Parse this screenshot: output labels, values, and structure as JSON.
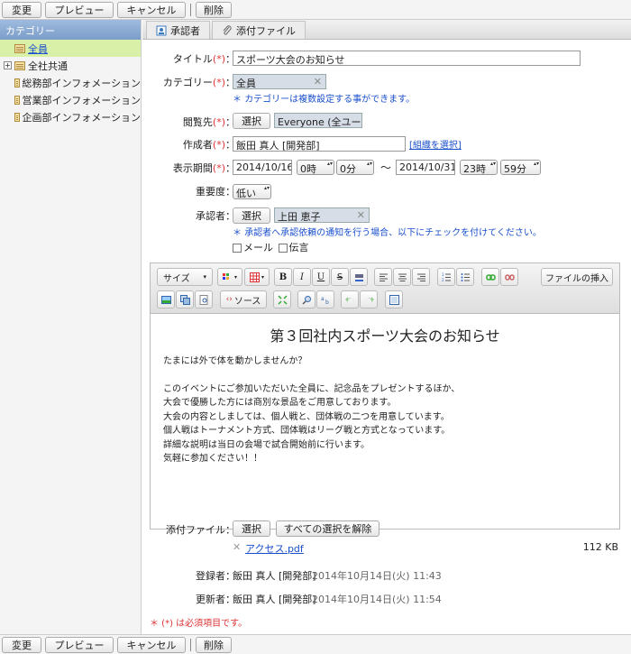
{
  "toolbar": {
    "change": "変更",
    "preview": "プレビュー",
    "cancel": "キャンセル",
    "delete": "削除"
  },
  "sidebar": {
    "header": "カテゴリー",
    "items": [
      {
        "label": "全員",
        "selected": true,
        "expandable": false
      },
      {
        "label": "全社共通",
        "selected": false,
        "expandable": true
      },
      {
        "label": "総務部インフォメーション",
        "selected": false,
        "expandable": false
      },
      {
        "label": "営業部インフォメーション",
        "selected": false,
        "expandable": false
      },
      {
        "label": "企画部インフォメーション",
        "selected": false,
        "expandable": false
      }
    ]
  },
  "tabs": [
    {
      "label": "承認者",
      "icon": "approver-icon"
    },
    {
      "label": "添付ファイル",
      "icon": "paperclip-icon"
    }
  ],
  "form": {
    "title": {
      "label": "タイトル",
      "req": "(*)",
      "value": "スポーツ大会のお知らせ"
    },
    "category": {
      "label": "カテゴリー",
      "req": "(*)",
      "value": "全員",
      "note": "カテゴリーは複数設定する事ができます。"
    },
    "viewers": {
      "label": "閲覧先",
      "req": "(*)",
      "select_label": "選択",
      "value": "Everyone (全ユー…"
    },
    "author": {
      "label": "作成者",
      "req": "(*)",
      "value": "飯田 真人 [開発部]",
      "link": "[組織を選択]"
    },
    "period": {
      "label": "表示期間",
      "req": "(*)",
      "start_date": "2014/10/16",
      "start_hour": "0時",
      "start_min": "0分",
      "tilde": "〜",
      "end_date": "2014/10/31",
      "end_hour": "23時",
      "end_min": "59分"
    },
    "priority": {
      "label": "重要度",
      "value": "低い"
    },
    "approver": {
      "label": "承認者",
      "select_label": "選択",
      "value": "上田 恵子",
      "note": "承認者へ承認依頼の通知を行う場合、以下にチェックを付けてください。",
      "mail": "メール",
      "message": "伝言"
    },
    "colon": "：",
    "note_mark": "＊"
  },
  "editor": {
    "size_label": "サイズ",
    "source_label": "ソース",
    "insert_file": "ファイルの挿入",
    "title": "第３回社内スポーツ大会のお知らせ",
    "lines": [
      "たまには外で体を動かしませんか？",
      "",
      "このイベントにご参加いただいた全員に、記念品をプレゼントするほか、",
      "大会で優勝した方には商別な景品をご用意しております。",
      "大会の内容としましては、個人戦と、団体戦の二つを用意しています。",
      "個人戦はトーナメント方式、団体戦はリーグ戦と方式となっています。",
      "詳細な説明は当日の会場で試合開始前に行います。",
      "気軽に参加ください！！"
    ]
  },
  "attachments": {
    "label": "添付ファイル",
    "select": "選択",
    "clear_all": "すべての選択を解除",
    "file_name": "アクセス.pdf",
    "file_size": "112 KB"
  },
  "registered": {
    "label": "登録者",
    "user": "飯田 真人 [開発部]",
    "date": "2014年10月14日(火) 11:43"
  },
  "updated": {
    "label": "更新者",
    "user": "飯田 真人 [開発部]",
    "date": "2014年10月14日(火) 11:54"
  },
  "required_note": "＊ (*) は必須項目です。",
  "colors": {
    "required": "#dd3333",
    "link": "#1a4fcc",
    "selected": "#d8f0a8",
    "header": "#7a9dc9"
  }
}
